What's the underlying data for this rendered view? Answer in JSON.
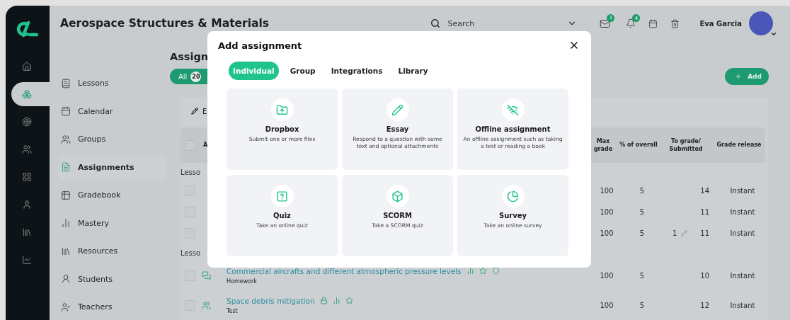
{
  "rail": {
    "items": [
      {
        "selected": false
      },
      {
        "selected": true
      },
      {
        "selected": false
      },
      {
        "selected": false
      },
      {
        "selected": false
      },
      {
        "selected": false
      },
      {
        "selected": false
      },
      {
        "selected": false
      }
    ]
  },
  "topbar": {
    "title": "Aerospace Structures & Materials",
    "search": {
      "placeholder": "Search"
    },
    "mail_badge": "1",
    "bell_badge": "4",
    "user_name": "Eva Garcia"
  },
  "nav": {
    "items": [
      {
        "label": "Lessons",
        "selected": false
      },
      {
        "label": "Calendar",
        "selected": false
      },
      {
        "label": "Groups",
        "selected": false
      },
      {
        "label": "Assignments",
        "selected": true
      },
      {
        "label": "Gradebook",
        "selected": false
      },
      {
        "label": "Mastery",
        "selected": false
      },
      {
        "label": "Resources",
        "selected": false
      },
      {
        "label": "Students",
        "selected": false
      },
      {
        "label": "Teachers",
        "selected": false
      }
    ]
  },
  "page": {
    "title": "Assign",
    "filter": {
      "label": "All",
      "count": "20"
    },
    "add_button": "Add",
    "toolbar_button": "E"
  },
  "table": {
    "header_checked": false,
    "columns": [
      "A",
      "Max grade",
      "% of overall",
      "To grade/ Submitted",
      "Grade release"
    ],
    "groups": [
      {
        "label": "Lesso",
        "rows": [
          {
            "checked": false,
            "max_grade": "100",
            "percent": "5",
            "to_grade": "",
            "submitted": "14",
            "release": "Instant"
          },
          {
            "checked": false,
            "max_grade": "100",
            "percent": "5",
            "to_grade": "",
            "submitted": "11",
            "release": "Instant"
          },
          {
            "checked": false,
            "max_grade": "100",
            "percent": "5",
            "to_grade": "1",
            "submitted": "11",
            "release": "Instant"
          }
        ]
      },
      {
        "label": "Lesso",
        "rows": [
          {
            "checked": false,
            "kind": "discussion",
            "title": "Commercial aircrafts and different atmospheric pressure levels",
            "badges": [
              {
                "kind": "stats"
              },
              {
                "kind": "star"
              },
              {
                "kind": "shield"
              }
            ],
            "subtitle": "Homework",
            "max_grade": "100",
            "percent": "5",
            "to_grade": "",
            "submitted": "10",
            "release": "Instant"
          },
          {
            "checked": false,
            "kind": "group",
            "title": "Space debris mitigation",
            "badges": [
              {
                "kind": "lock"
              },
              {
                "kind": "stats"
              },
              {
                "kind": "star"
              }
            ],
            "subtitle": "Test",
            "max_grade": "100",
            "percent": "5",
            "to_grade": "",
            "submitted": "12",
            "release": "Instant"
          }
        ]
      }
    ]
  },
  "dialog": {
    "title": "Add assignment",
    "tabs": [
      {
        "label": "Individual",
        "selected": true
      },
      {
        "label": "Group",
        "selected": false
      },
      {
        "label": "Integrations",
        "selected": false
      },
      {
        "label": "Library",
        "selected": false
      }
    ],
    "options": [
      {
        "kind": "dropbox",
        "title": "Dropbox",
        "description": "Submit one or more files"
      },
      {
        "kind": "essay",
        "title": "Essay",
        "description": "Respond to a question with some text and optional attachments"
      },
      {
        "kind": "offline",
        "title": "Offline assignment",
        "description": "An offline assignment such as taking a test or reading a book"
      },
      {
        "kind": "quiz",
        "title": "Quiz",
        "description": "Take an online quiz"
      },
      {
        "kind": "scorm",
        "title": "SCORM",
        "description": "Take a SCORM quiz"
      },
      {
        "kind": "survey",
        "title": "Survey",
        "description": "Take an online survey"
      }
    ]
  }
}
